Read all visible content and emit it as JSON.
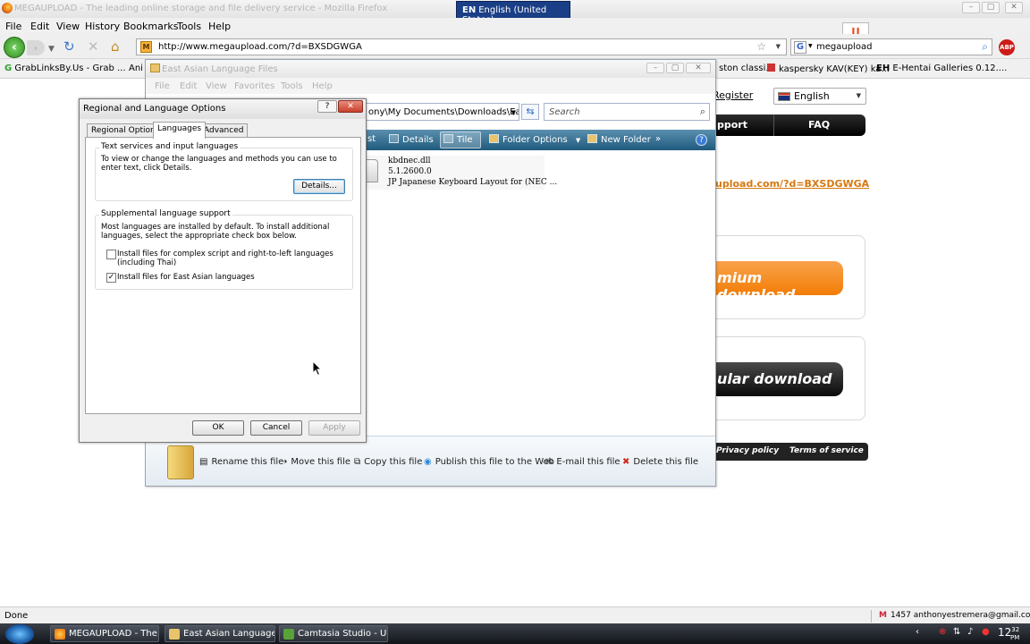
{
  "browser": {
    "title": "MEGAUPLOAD - The leading online storage and file delivery service - Mozilla Firefox",
    "input_language": "EN",
    "input_language_name": "English (United States)",
    "menu": [
      "File",
      "Edit",
      "View",
      "History",
      "Bookmarks",
      "Tools",
      "Help"
    ],
    "url": "http://www.megaupload.com/?d=BXSDGWGA",
    "search_value": "megaupload",
    "search_engine_icon": "G",
    "abp_label": "ABP",
    "bookmarks": [
      "GrabLinksBy.Us - Grab ...",
      "Ani",
      "ston classi...",
      "kaspersky KAV(KEY) ka...",
      "E-Hentai Galleries 0.12...."
    ],
    "bookmark_eh_badge": "EH",
    "status": "Done",
    "mail_count": "1457",
    "mail_account": "anthonyestremera@gmail.com"
  },
  "site": {
    "register": "Register",
    "language": "English",
    "nav": [
      "pport",
      "FAQ"
    ],
    "link": "upload.com/?d=BXSDGWGA",
    "premium_button": "mium download",
    "regular_button": "ular download",
    "footer": [
      "Privacy policy",
      "Terms of service"
    ]
  },
  "explorer": {
    "title": "East Asian Language Files",
    "menu": [
      "File",
      "Edit",
      "View",
      "Favorites",
      "Tools",
      "Help"
    ],
    "address": "ony\\My Documents\\Downloads\\East A",
    "search_placeholder": "Search",
    "toolbar": [
      "st",
      "Details",
      "Tile",
      "Folder Options",
      "New Folder",
      "»"
    ],
    "help_icon": "?",
    "file": {
      "name": "kbdnec.dll",
      "version": "5.1.2600.0",
      "description": "JP Japanese Keyboard Layout for (NEC ..."
    },
    "tasks": [
      "Rename this file",
      "Move this file",
      "Copy this file",
      "Publish this file to the Web",
      "E-mail this file",
      "Delete this file"
    ]
  },
  "dialog": {
    "title": "Regional and Language Options",
    "tabs": [
      "Regional Options",
      "Languages",
      "Advanced"
    ],
    "group1": {
      "label": "Text services and input languages",
      "text": "To view or change the languages and methods you can use to enter text, click Details.",
      "button": "Details..."
    },
    "group2": {
      "label": "Supplemental language support",
      "text": "Most languages are installed by default. To install additional languages, select the appropriate check box below.",
      "check1": "Install files for complex script and right-to-left languages (including Thai)",
      "check2": "Install files for East Asian languages"
    },
    "buttons": [
      "OK",
      "Cancel",
      "Apply"
    ]
  },
  "taskbar": {
    "items": [
      "MEGAUPLOAD - The...",
      "East Asian Language ...",
      "Camtasia Studio - U..."
    ],
    "clock": "12",
    "clock_min": "32",
    "clock_ampm": "PM"
  }
}
